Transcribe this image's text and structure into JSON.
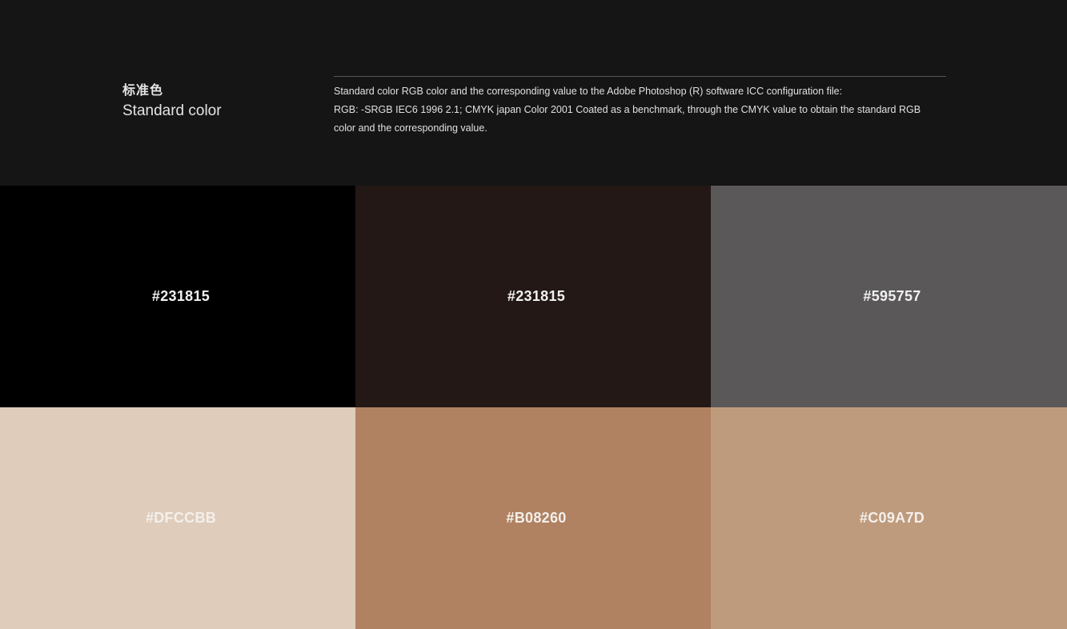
{
  "header": {
    "title_cn": "标准色",
    "title_en": "Standard color",
    "description_line1": "Standard color RGB color and the corresponding value to the Adobe Photoshop (R) software ICC configuration file:",
    "description_line2": "RGB: -SRGB IEC6 1996 2.1; CMYK japan Color 2001 Coated as a benchmark, through the CMYK value to obtain the standard RGB",
    "description_line3": "color and the corresponding value."
  },
  "swatches": [
    {
      "label": "#231815",
      "color": "#000000"
    },
    {
      "label": "#231815",
      "color": "#231815"
    },
    {
      "label": "#595757",
      "color": "#5a5859"
    },
    {
      "label": "#DFCCBB",
      "color": "#dfccbb"
    },
    {
      "label": "#B08260",
      "color": "#b08262"
    },
    {
      "label": "#C09A7D",
      "color": "#bf9b7d"
    }
  ]
}
